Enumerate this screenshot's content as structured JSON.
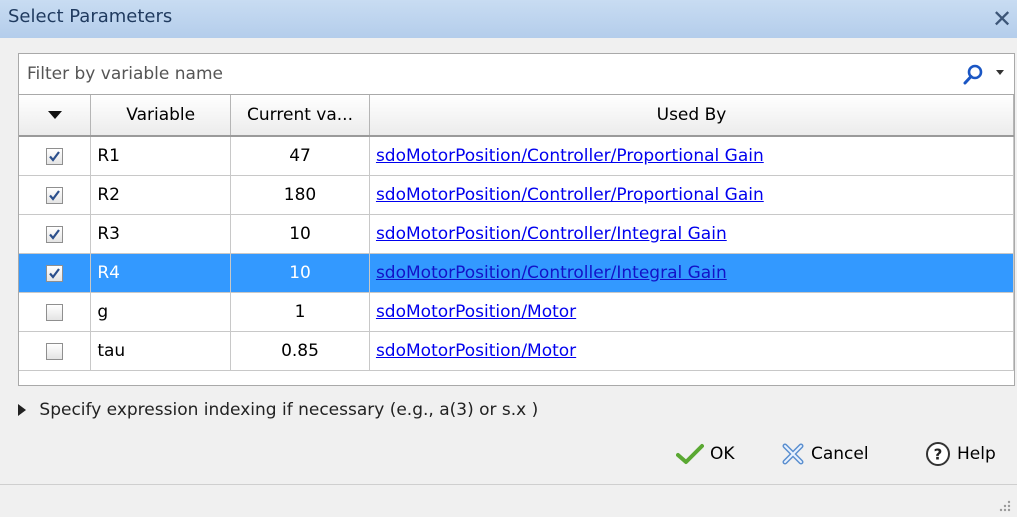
{
  "window": {
    "title": "Select Parameters"
  },
  "filter": {
    "placeholder": "Filter by variable name",
    "value": ""
  },
  "table": {
    "columns": {
      "select": "▼",
      "variable": "Variable",
      "current": "Current va...",
      "used_by": "Used By"
    },
    "rows": [
      {
        "checked": true,
        "variable": "R1",
        "current": "47",
        "used_by": "sdoMotorPosition/Controller/Proportional Gain",
        "selected": false
      },
      {
        "checked": true,
        "variable": "R2",
        "current": "180",
        "used_by": "sdoMotorPosition/Controller/Proportional Gain",
        "selected": false
      },
      {
        "checked": true,
        "variable": "R3",
        "current": "10",
        "used_by": "sdoMotorPosition/Controller/Integral Gain",
        "selected": false
      },
      {
        "checked": true,
        "variable": "R4",
        "current": "10",
        "used_by": "sdoMotorPosition/Controller/Integral Gain",
        "selected": true
      },
      {
        "checked": false,
        "variable": "g",
        "current": "1",
        "used_by": "sdoMotorPosition/Motor",
        "selected": false
      },
      {
        "checked": false,
        "variable": "tau",
        "current": "0.85",
        "used_by": "sdoMotorPosition/Motor",
        "selected": false
      }
    ]
  },
  "expression": {
    "label": "Specify expression indexing if necessary (e.g., a(3) or s.x )"
  },
  "buttons": {
    "ok": "OK",
    "cancel": "Cancel",
    "help": "Help"
  },
  "colors": {
    "selection": "#3399ff",
    "link": "#0000ee",
    "title_bg": "#c8dcf2"
  },
  "icons": [
    "close-icon",
    "search-icon",
    "dropdown-arrow-icon",
    "sort-arrow-icon",
    "checkbox",
    "triangle-right-icon",
    "ok-check-icon",
    "cancel-x-icon",
    "help-icon",
    "resize-grip-icon"
  ]
}
